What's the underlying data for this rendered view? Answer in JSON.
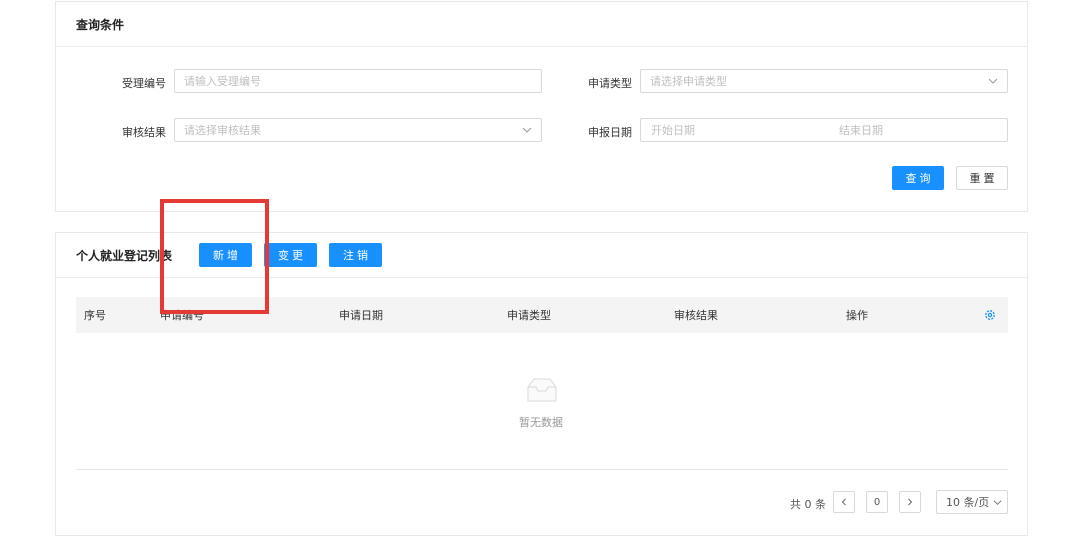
{
  "query": {
    "title": "查询条件",
    "accept_no": {
      "label": "受理编号",
      "placeholder": "请输入受理编号"
    },
    "apply_type": {
      "label": "申请类型",
      "placeholder": "请选择申请类型"
    },
    "audit_result": {
      "label": "审核结果",
      "placeholder": "请选择审核结果"
    },
    "report_date": {
      "label": "申报日期",
      "start_placeholder": "开始日期",
      "end_placeholder": "结束日期"
    },
    "search_label": "查询",
    "reset_label": "重置"
  },
  "list": {
    "title": "个人就业登记列表",
    "add_label": "新增",
    "change_label": "变更",
    "cancel_label": "注销",
    "columns": [
      "序号",
      "申请编号",
      "申请日期",
      "申请类型",
      "审核结果",
      "操作"
    ],
    "empty_text": "暂无数据"
  },
  "pagination": {
    "total_text": "共 0 条",
    "current_page": "0",
    "page_size": "10 条/页"
  },
  "colors": {
    "primary": "#1890ff",
    "highlight": "#e53935"
  }
}
